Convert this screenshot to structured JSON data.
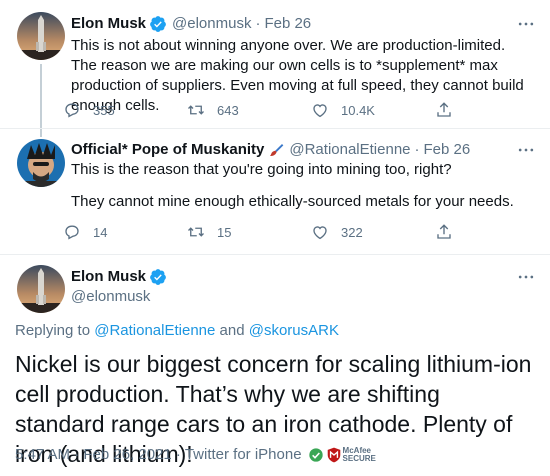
{
  "tweet1": {
    "name": "Elon Musk",
    "handle": "@elonmusk",
    "sep": "·",
    "date": "Feb 26",
    "text": "This is not about winning anyone over. We are production-limited. The reason we are making our own cells is to *supplement* max production of suppliers. Even moving at full speed, they cannot build enough cells.",
    "replies": "355",
    "retweets": "643",
    "likes": "10.4K"
  },
  "tweet2": {
    "name": "Official* Pope of Muskanity",
    "handle": "@RationalEtienne",
    "sep": "·",
    "date": "Feb 26",
    "text_line1": "This is the reason that you're going into mining too, right?",
    "text_line2": "They cannot mine enough ethically-sourced metals for your needs.",
    "replies": "14",
    "retweets": "15",
    "likes": "322"
  },
  "main": {
    "name": "Elon Musk",
    "handle": "@elonmusk",
    "replying_prefix": "Replying to ",
    "mention1": "@RationalEtienne",
    "and_word": " and ",
    "mention2": "@skorusARK",
    "text": "Nickel is our biggest concern for scaling lithium-ion cell production. That’s why we are shifting standard range cars to an iron cathode. Plenty of iron (and lithium)!",
    "timestamp": "5:47 AM · Feb 26, 2021 · Twitter for iPhone",
    "mcafee_line1": "McAfee",
    "mcafee_line2": "SECURE"
  },
  "colors": {
    "verified": "#1da1f2",
    "link": "#1b95e0",
    "secondary_text": "#5b7083",
    "mcafee_red": "#c01818"
  },
  "icons": [
    "verified-badge-icon",
    "more-icon",
    "reply-icon",
    "retweet-icon",
    "like-icon",
    "share-icon",
    "paintbrush-icon",
    "mcafee-shield-icon"
  ]
}
